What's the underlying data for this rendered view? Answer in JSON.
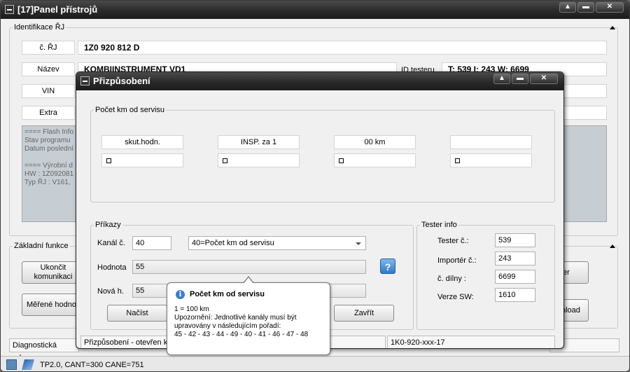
{
  "main": {
    "title": "[17]Panel přístrojů",
    "ident_group": "Identifikace ŘJ",
    "rows": [
      {
        "label": "č. ŘJ",
        "value": "1Z0 920 812 D"
      },
      {
        "label": "Název",
        "value": "KOMBIINSTRUMENT VD1"
      },
      {
        "label": "VIN",
        "value": ""
      },
      {
        "label": "Extra",
        "value": ""
      }
    ],
    "tester_id_label": "ID testeru",
    "tester_id_value": "T: 539 I: 243 W: 6699",
    "info_lines": [
      "==== Flash Info",
      "Stav programu",
      "Datum poslední",
      "",
      "==== Výrobní d",
      "HW : 1Z092081",
      "Typ ŘJ : V161,"
    ],
    "basic_group": "Základní funkce",
    "btn_end": "Ukončit komunikaci",
    "btn_measured": "Měřené hodnot",
    "btn_right1": "er",
    "btn_right2": "nload",
    "status_left": "Diagnostická relace",
    "status_bar": "TP2.0, CANT=300 CANE=751"
  },
  "dialog": {
    "title": "Přizpůsobení",
    "km_group": "Počet km od servisu",
    "cells": [
      "skut.hodn.",
      "INSP. za 1",
      "00 km",
      ""
    ],
    "cmd_group": "Příkazy",
    "channel_label": "Kanál č.",
    "channel_value": "40",
    "channel_select": "40=Počet km od servisu",
    "value_label": "Hodnota",
    "value_value": "55",
    "new_label": "Nová h.",
    "new_value": "55",
    "btn_read": "Načíst",
    "btn_close": "Zavřít",
    "help_glyph": "?",
    "tester_group": "Tester info",
    "tester": [
      {
        "label": "Tester č.:",
        "value": "539"
      },
      {
        "label": "Importér č.:",
        "value": "243"
      },
      {
        "label": "č. dílny :",
        "value": "6699"
      },
      {
        "label": "Verze SW:",
        "value": "1610"
      }
    ],
    "status_left": "Přizpůsobení - otevřen ka",
    "status_right": "1K0-920-xxx-17"
  },
  "tooltip": {
    "title": "Počet km od servisu",
    "lines": [
      "1 = 100 km",
      "Upozornění: Jednotlivé kanály musí být",
      "upravovány v následujícím pořadí:",
      "45 - 42 - 43 - 44 - 49 - 40 - 41 - 46 - 47 - 48"
    ]
  },
  "window_controls": {
    "minimize": "▲",
    "restore": "▬",
    "close": "✕"
  }
}
